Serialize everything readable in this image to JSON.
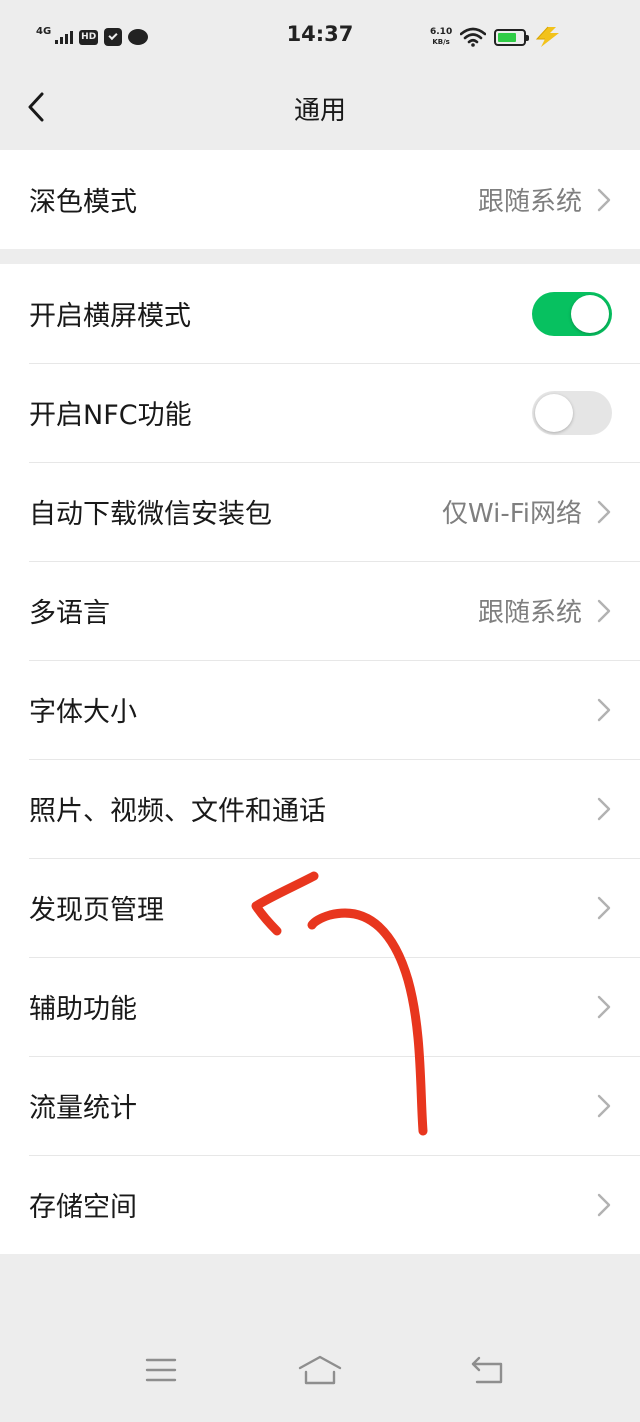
{
  "status_bar": {
    "network_type": "4G",
    "hd_label": "HD",
    "time": "14:37",
    "net_speed_value": "6.10",
    "net_speed_unit": "KB/s",
    "battery_level": 0.75,
    "battery_color": "#2fcc46",
    "icons": [
      "signal-icon",
      "hd-icon",
      "app-notification-icon",
      "chat-notification-icon",
      "wifi-icon",
      "battery-icon",
      "charging-icon"
    ]
  },
  "header": {
    "title": "通用",
    "back_icon": "chevron-left-icon"
  },
  "settings": {
    "group1": [
      {
        "label": "深色模式",
        "value": "跟随系统"
      }
    ],
    "landscape": {
      "label": "开启横屏模式",
      "enabled": true
    },
    "nfc": {
      "label": "开启NFC功能",
      "enabled": false
    },
    "group2": [
      {
        "label": "自动下载微信安装包",
        "value": "仅Wi-Fi网络"
      },
      {
        "label": "多语言",
        "value": "跟随系统"
      },
      {
        "label": "字体大小",
        "value": ""
      },
      {
        "label": "照片、视频、文件和通话",
        "value": ""
      },
      {
        "label": "发现页管理",
        "value": ""
      },
      {
        "label": "辅助功能",
        "value": ""
      },
      {
        "label": "流量统计",
        "value": ""
      },
      {
        "label": "存储空间",
        "value": ""
      }
    ]
  },
  "colors": {
    "toggle_on": "#07c160",
    "toggle_off": "#e5e5e5",
    "annotation_arrow": "#e8361e",
    "background": "#ededed"
  },
  "nav_bar": {
    "icons": [
      "menu-icon",
      "home-icon",
      "back-icon"
    ]
  }
}
